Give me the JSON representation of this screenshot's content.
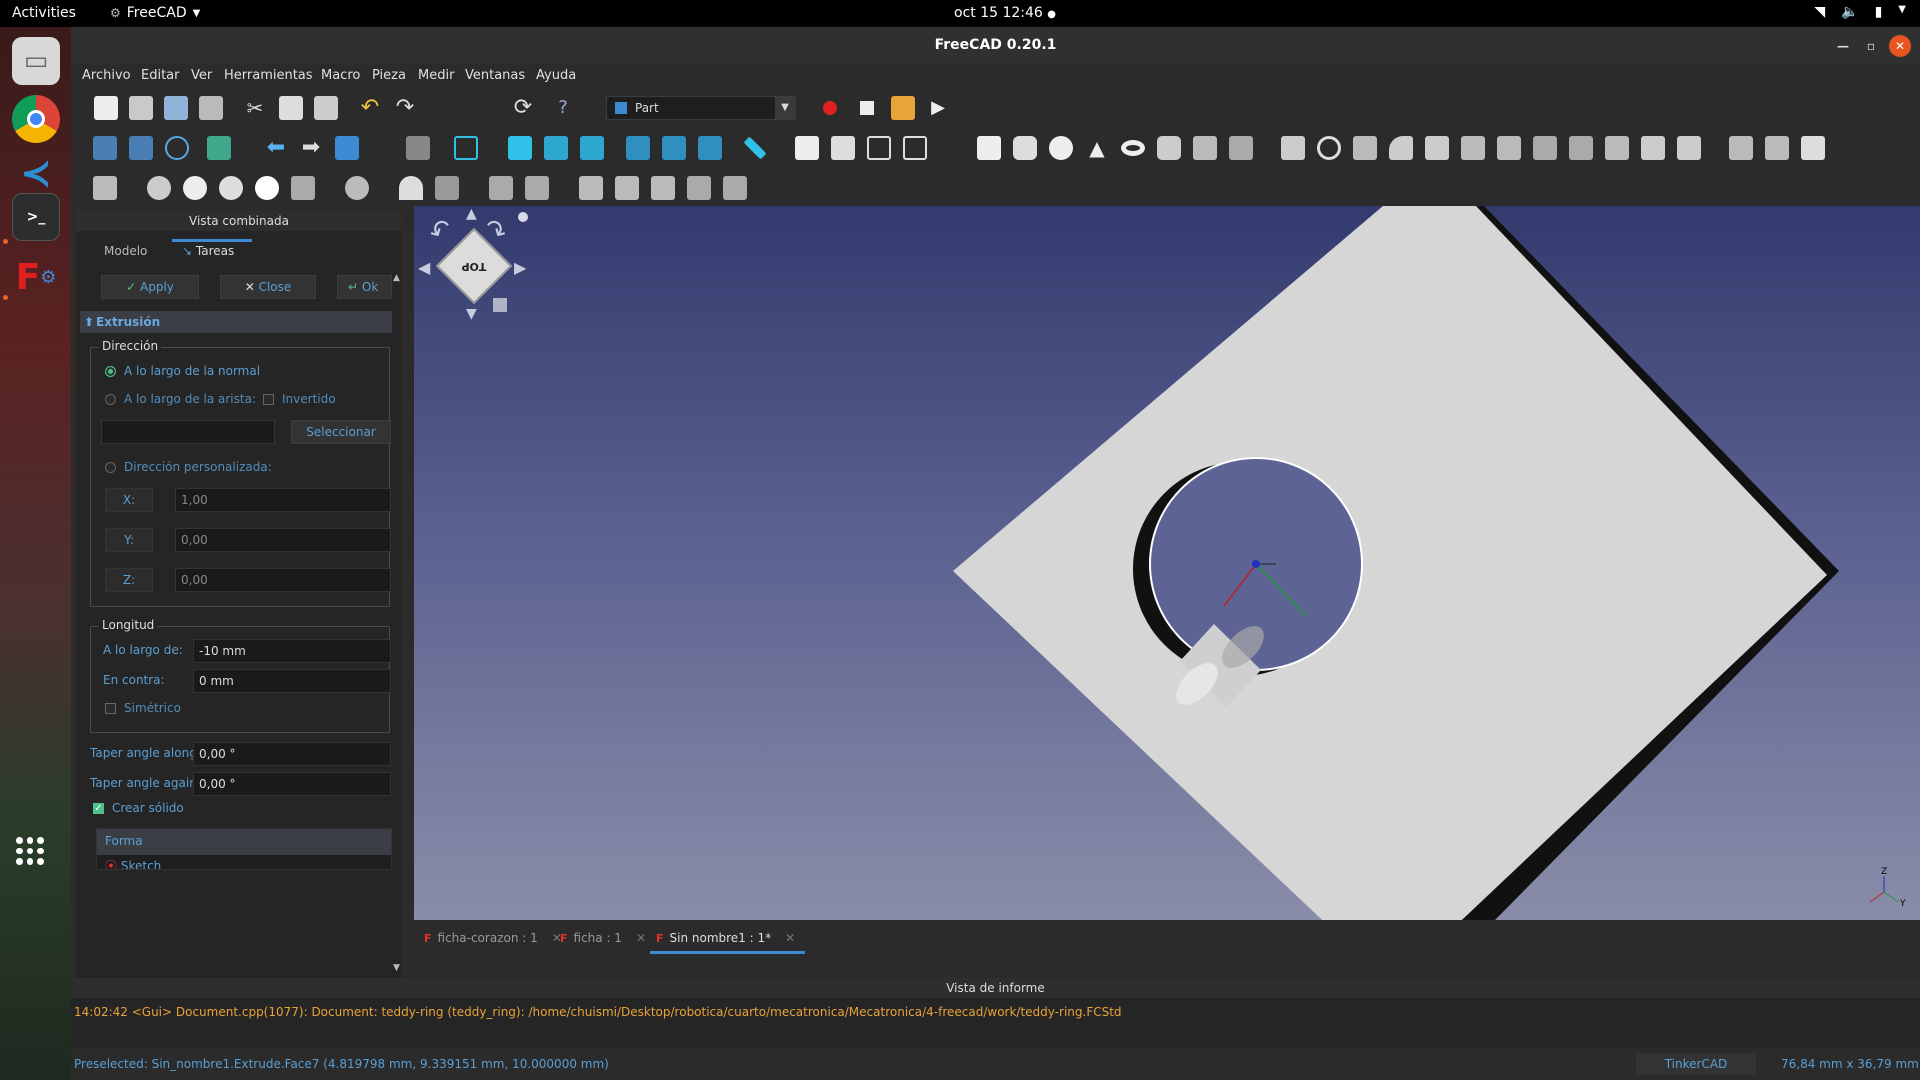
{
  "topbar": {
    "activities": "Activities",
    "app_name": "FreeCAD",
    "clock": "oct 15  12:46"
  },
  "window": {
    "title": "FreeCAD 0.20.1"
  },
  "menu": [
    "Archivo",
    "Editar",
    "Ver",
    "Herramientas",
    "Macro",
    "Pieza",
    "Medir",
    "Ventanas",
    "Ayuda"
  ],
  "toolbar": {
    "workbench": "Part"
  },
  "combo": {
    "header": "Vista combinada",
    "tab_model": "Modelo",
    "tab_tasks": "Tareas"
  },
  "task": {
    "apply": "Apply",
    "close": "Close",
    "ok": "Ok",
    "section_title": "Extrusión",
    "direction": {
      "title": "Dirección",
      "along_normal": "A lo largo de la normal",
      "along_edge": "A lo largo de la arista:",
      "inverted": "Invertido",
      "select": "Seleccionar",
      "custom": "Dirección personalizada:",
      "x_label": "X:",
      "x_value": "1,00",
      "y_label": "Y:",
      "y_value": "0,00",
      "z_label": "Z:",
      "z_value": "0,00"
    },
    "length": {
      "title": "Longitud",
      "along_label": "A lo largo de:",
      "along_value": "-10 mm",
      "against_label": "En contra:",
      "against_value": "0 mm",
      "symmetric": "Simétrico"
    },
    "taper_along_label": "Taper angle along",
    "taper_along_value": "0,00 °",
    "taper_against_label": "Taper angle against",
    "taper_against_value": "0,00 °",
    "create_solid": "Crear sólido",
    "shape_header": "Forma",
    "shape_item": "Sketch"
  },
  "navicube": {
    "face": "TOP"
  },
  "doc_tabs": [
    {
      "label": "ficha-corazon : 1"
    },
    {
      "label": "ficha : 1"
    },
    {
      "label": "Sin nombre1 : 1*"
    }
  ],
  "report": {
    "header": "Vista de informe",
    "line": "14:02:42  <Gui> Document.cpp(1077):   Document: teddy-ring (teddy_ring): /home/chuismi/Desktop/robotica/cuarto/mecatronica/Mecatronica/4-freecad/work/teddy-ring.FCStd"
  },
  "status": {
    "message": "Preselected: Sin_nombre1.Extrude.Face7 (4.819798 mm, 9.339151 mm, 10.000000 mm)",
    "nav_style": "TinkerCAD",
    "dimensions": "76,84 mm x 36,79 mm"
  },
  "colors": {
    "accent": "#3d8bd4",
    "label_blue": "#5a9fd4",
    "report_orange": "#e8a33a",
    "check_green": "#4ec08a"
  }
}
